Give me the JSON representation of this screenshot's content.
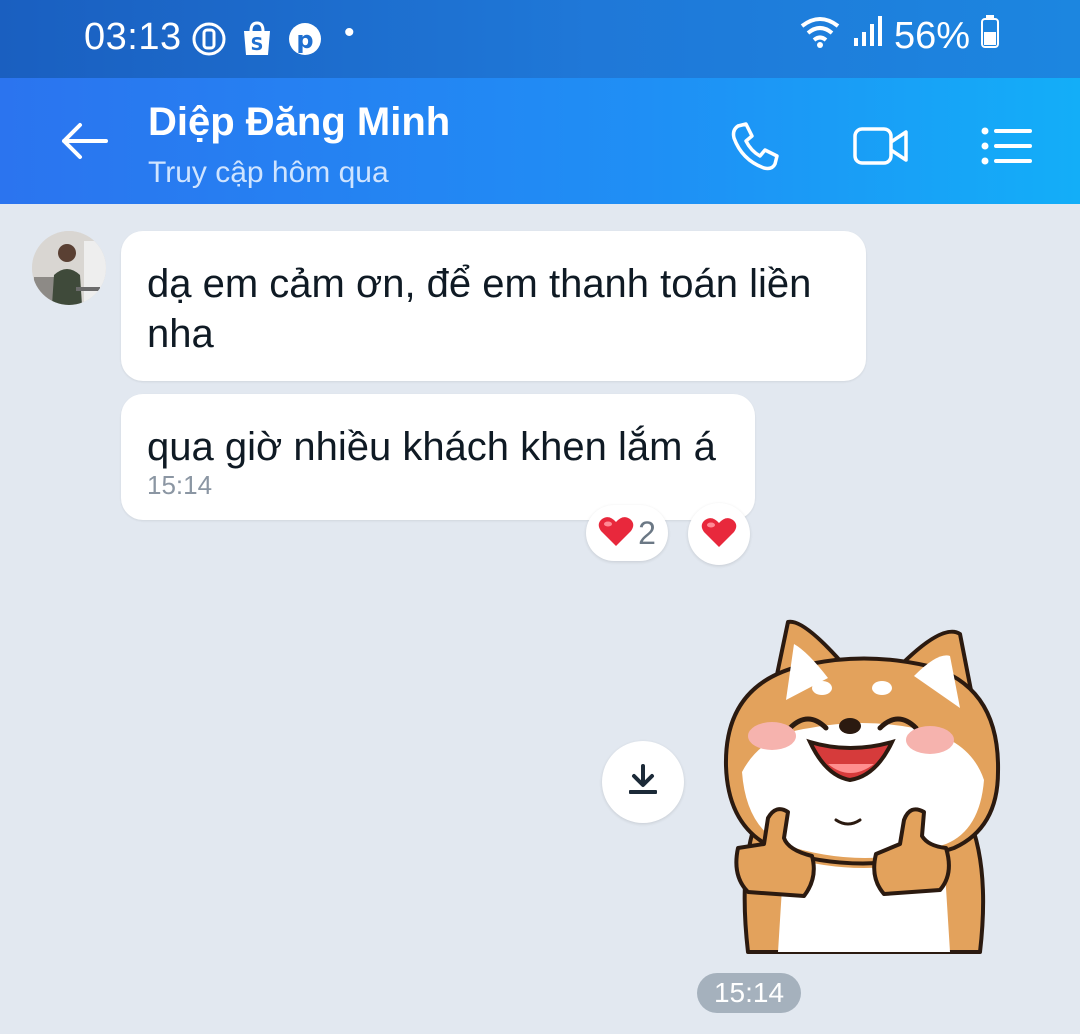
{
  "status_bar": {
    "time": "03:13",
    "battery": "56%",
    "icons": [
      "pin-icon",
      "shopee-icon",
      "pinterest-icon",
      "notification-dot-icon",
      "wifi-icon",
      "signal-icon",
      "battery-icon"
    ]
  },
  "header": {
    "contact_name": "Diệp Đăng Minh",
    "status": "Truy cập hôm qua",
    "buttons": [
      "back-arrow-icon",
      "phone-icon",
      "video-call-icon",
      "menu-list-icon"
    ]
  },
  "messages": [
    {
      "sender": "contact",
      "text": "dạ em cảm ơn, để em thanh toán liền nha"
    },
    {
      "sender": "contact",
      "text": "qua giờ nhiều khách khen lắm á",
      "time": "15:14",
      "reactions": [
        {
          "emoji": "❤️",
          "count": "2"
        },
        {
          "emoji": "❤️"
        }
      ]
    },
    {
      "sender": "me",
      "type": "sticker",
      "sticker": "shiba-thumbs-up",
      "time": "15:14"
    }
  ],
  "colors": {
    "header_gradient_start": "#2b74ef",
    "header_gradient_end": "#13aef8",
    "chat_background": "#e2e8f0",
    "heart": "#e8283c"
  }
}
